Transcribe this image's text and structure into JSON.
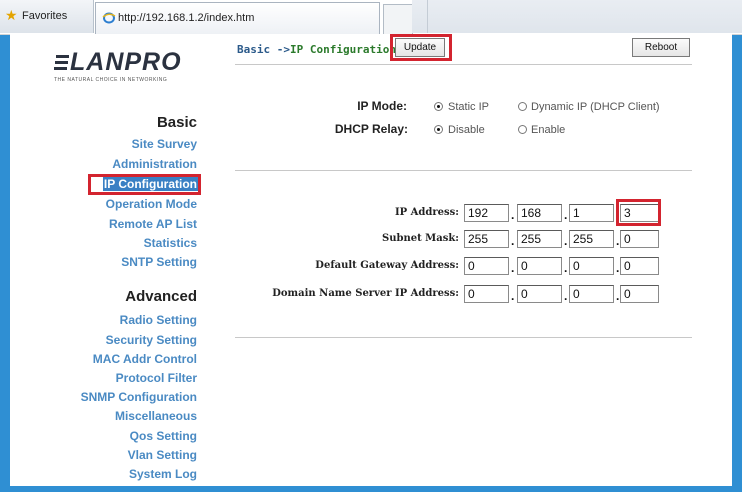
{
  "browser": {
    "favorites_label": "Favorites",
    "tab_url": "http://192.168.1.2/index.htm"
  },
  "logo": {
    "text": "LANPRO",
    "tagline": "THE NATURAL CHOICE IN NETWORKING"
  },
  "sidebar": {
    "basic_title": "Basic",
    "basic_items": [
      "Site Survey",
      "Administration",
      "IP Configuration",
      "Operation Mode",
      "Remote AP List",
      "Statistics",
      "SNTP Setting"
    ],
    "advanced_title": "Advanced",
    "advanced_items": [
      "Radio Setting",
      "Security Setting",
      "MAC Addr Control",
      "Protocol Filter",
      "SNMP Configuration",
      "Miscellaneous",
      "Qos Setting",
      "Vlan Setting",
      "System Log"
    ]
  },
  "header": {
    "breadcrumb_prefix": "Basic ->",
    "breadcrumb_current": "IP Configuration",
    "update_label": "Update",
    "reboot_label": "Reboot"
  },
  "mode": {
    "ip_mode_label": "IP Mode:",
    "ip_mode_options": [
      "Static IP",
      "Dynamic IP (DHCP Client)"
    ],
    "ip_mode_selected": "Static IP",
    "dhcp_relay_label": "DHCP Relay:",
    "dhcp_relay_options": [
      "Disable",
      "Enable"
    ],
    "dhcp_relay_selected": "Disable"
  },
  "fields": [
    {
      "label": "IP Address:",
      "octets": [
        "192",
        "168",
        "1",
        "3"
      ]
    },
    {
      "label": "Subnet Mask:",
      "octets": [
        "255",
        "255",
        "255",
        "0"
      ]
    },
    {
      "label": "Default Gateway Address:",
      "octets": [
        "0",
        "0",
        "0",
        "0"
      ]
    },
    {
      "label": "Domain Name Server IP Address:",
      "octets": [
        "0",
        "0",
        "0",
        "0"
      ]
    }
  ],
  "colors": {
    "accent": "#3a80c4",
    "highlight": "#d3242f",
    "link": "#4a8ac3"
  }
}
